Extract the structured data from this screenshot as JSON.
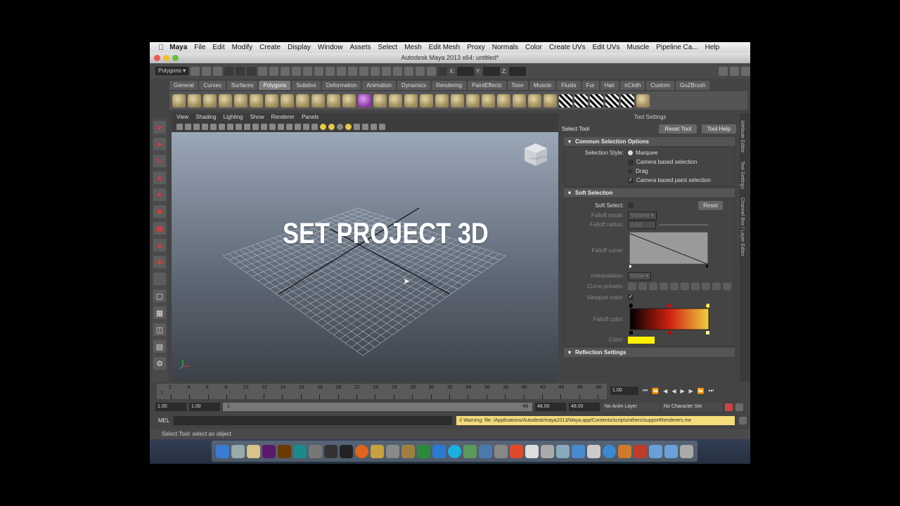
{
  "menubar": {
    "app": "Maya",
    "items": [
      "File",
      "Edit",
      "Modify",
      "Create",
      "Display",
      "Window",
      "Assets",
      "Select",
      "Mesh",
      "Edit Mesh",
      "Proxy",
      "Normals",
      "Color",
      "Create UVs",
      "Edit UVs",
      "Muscle",
      "Pipeline Ca...",
      "Help"
    ]
  },
  "window": {
    "title": "Autodesk Maya 2013 x64: untitled*"
  },
  "statusline": {
    "menuset": "Polygons",
    "x_label": "X:",
    "y_label": "Y:",
    "z_label": "Z:"
  },
  "shelf": {
    "tabs": [
      "General",
      "Curves",
      "Surfaces",
      "Polygons",
      "Subdivs",
      "Deformation",
      "Animation",
      "Dynamics",
      "Rendering",
      "PaintEffects",
      "Toon",
      "Muscle",
      "Fluids",
      "Fur",
      "Hair",
      "nCloth",
      "Custom",
      "GoZBrush"
    ],
    "active_tab": "Polygons"
  },
  "viewport": {
    "menus": [
      "View",
      "Shading",
      "Lighting",
      "Show",
      "Renderer",
      "Panels"
    ],
    "overlay_text": "SET PROJECT 3D",
    "viewcube_front": "FRONT",
    "viewcube_right": "RIGHT"
  },
  "tool_settings": {
    "header": "Tool Settings",
    "tool_name": "Select Tool",
    "reset_tool": "Reset Tool",
    "tool_help": "Tool Help",
    "common_section": "Common Selection Options",
    "selection_style_label": "Selection Style:",
    "marquee": "Marquee",
    "camera_based_selection": "Camera based selection",
    "drag": "Drag",
    "camera_based_paint_selection": "Camera based paint selection",
    "soft_section": "Soft Selection",
    "soft_select_label": "Soft Select:",
    "reset": "Reset",
    "falloff_mode_label": "Falloff mode:",
    "falloff_mode_value": "Volume",
    "falloff_radius_label": "Falloff radius:",
    "falloff_radius_value": "0.50",
    "falloff_curve_label": "Falloff curve:",
    "interpolation_label": "Interpolation:",
    "interpolation_value": "None",
    "curve_presets_label": "Curve presets:",
    "viewport_color_label": "Viewport color:",
    "falloff_color_label": "Falloff color:",
    "color_label": "Color:",
    "reflection_section": "Reflection Settings",
    "side_tabs": [
      "Attribute Editor",
      "Tool Settings",
      "Channel Box / Layer Editor"
    ]
  },
  "timeline": {
    "ticks": [
      "2",
      "4",
      "6",
      "8",
      "10",
      "12",
      "14",
      "16",
      "18",
      "20",
      "22",
      "24",
      "26",
      "28",
      "30",
      "32",
      "34",
      "36",
      "38",
      "40",
      "42",
      "44",
      "46",
      "48"
    ],
    "current_frame_marker": "1",
    "current_time": "1.00"
  },
  "range": {
    "start": "1.00",
    "playback_start": "1.00",
    "slider_start": "1",
    "slider_end": "48",
    "playback_end": "48.00",
    "end": "48.00",
    "anim_layer": "No Anim Layer",
    "character_set": "No Character Set"
  },
  "command": {
    "label": "MEL",
    "warning": "// Warning: file: /Applications/Autodesk/maya2013/Maya.app/Contents/scripts/others/supportRenderers.me"
  },
  "helpline": {
    "text": "Select Tool: select an object"
  },
  "colors": {
    "ui_bg": "#444444",
    "accent_soft_color": "#fff200",
    "warning_bg": "#f4dc7a"
  }
}
